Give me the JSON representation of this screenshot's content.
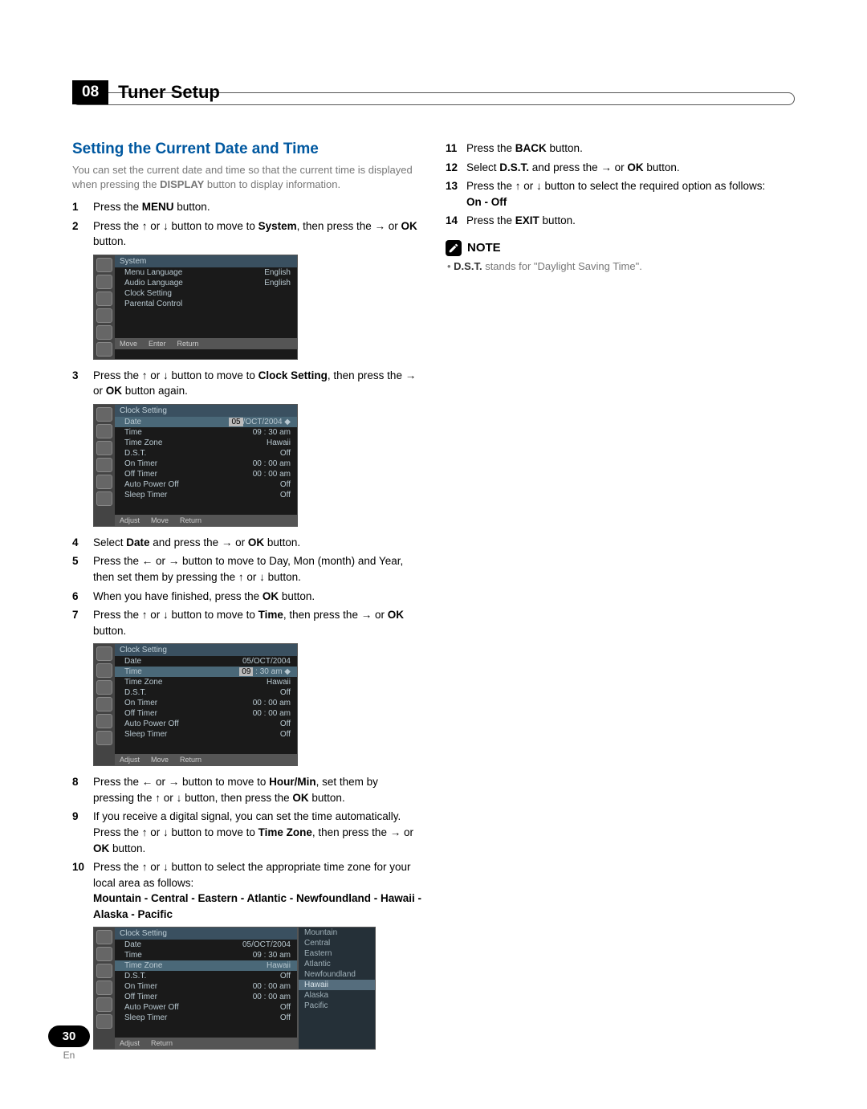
{
  "chapter": {
    "number": "08",
    "title": "Tuner Setup"
  },
  "section": {
    "heading": "Setting the Current Date and Time",
    "intro_a": "You can set the current date and time so that the current time is displayed when pressing the ",
    "intro_bold": "DISPLAY",
    "intro_b": " button to display information."
  },
  "left_steps": {
    "s1": {
      "n": "1",
      "a": "Press the ",
      "b": "MENU",
      "c": " button."
    },
    "s2": {
      "n": "2",
      "a": "Press the ",
      "b1": "↑",
      "mid1": " or ",
      "b2": "↓",
      "c": " button to move to ",
      "d": "System",
      "e": ", then press the ",
      "f": "→",
      "g": " or ",
      "h": "OK",
      "i": " button."
    },
    "s3": {
      "n": "3",
      "a": "Press the ",
      "b1": "↑",
      "mid1": " or ",
      "b2": "↓",
      "c": " button to move to ",
      "d": "Clock Setting",
      "e": ", then press the ",
      "f": "→",
      "g": " or ",
      "h": "OK",
      "i": " button again."
    },
    "s4": {
      "n": "4",
      "a": "Select ",
      "b": "Date",
      "c": " and press the ",
      "d": "→",
      "e": " or ",
      "f": "OK",
      "g": " button."
    },
    "s5": {
      "n": "5",
      "a": "Press the ",
      "b1": "←",
      "mid1": " or ",
      "b2": "→",
      "c": " button to move to Day, Mon (month) and Year, then set them by pressing the ",
      "d1": "↑",
      "mid2": " or ",
      "d2": "↓",
      "e": " button."
    },
    "s6": {
      "n": "6",
      "a": "When you have finished, press the ",
      "b": "OK",
      "c": " button."
    },
    "s7": {
      "n": "7",
      "a": "Press the ",
      "b1": "↑",
      "mid1": " or ",
      "b2": "↓",
      "c": " button to move to ",
      "d": "Time",
      "e": ", then press the ",
      "f": "→",
      "g": " or ",
      "h": "OK",
      "i": " button."
    },
    "s8": {
      "n": "8",
      "a": "Press the ",
      "b1": "←",
      "mid1": " or ",
      "b2": "→",
      "c": " button to move to ",
      "d": "Hour/Min",
      "e": ", set them by pressing the ",
      "f1": "↑",
      "mid2": " or ",
      "f2": "↓",
      "g": " button, then press the ",
      "h": "OK",
      "i": " button."
    },
    "s9": {
      "n": "9",
      "a": "If you receive a digital signal, you can set the time automatically. Press the ",
      "b1": "↑",
      "mid1": " or ",
      "b2": "↓",
      "c": " button to move to ",
      "d": "Time Zone",
      "e": ", then press the ",
      "f": "→",
      "g": " or ",
      "h": "OK",
      "i": " button."
    },
    "s10": {
      "n": "10",
      "a": "Press the ",
      "b1": "↑",
      "mid1": " or ",
      "b2": "↓",
      "c": " button to select the appropriate time zone for your local area as follows:",
      "list": "Mountain - Central - Eastern - Atlantic - Newfoundland - Hawaii - Alaska - Pacific"
    }
  },
  "right_steps": {
    "s11": {
      "n": "11",
      "a": "Press the ",
      "b": "BACK",
      "c": " button."
    },
    "s12": {
      "n": "12",
      "a": "Select ",
      "b": "D.S.T.",
      "c": " and press the ",
      "d": "→",
      "e": " or ",
      "f": "OK",
      "g": " button."
    },
    "s13": {
      "n": "13",
      "a": "Press the ",
      "b1": "↑",
      "mid1": " or ",
      "b2": "↓",
      "c": " button to select the required option as follows:",
      "opts": "On - Off"
    },
    "s14": {
      "n": "14",
      "a": "Press the ",
      "b": "EXIT",
      "c": " button."
    }
  },
  "note": {
    "label": "NOTE",
    "bullet": "• ",
    "bold": "D.S.T.",
    "text": " stands for \"Daylight Saving Time\"."
  },
  "osd1": {
    "title": "System",
    "rows": [
      {
        "label": "Menu Language",
        "value": "English"
      },
      {
        "label": "Audio Language",
        "value": "English"
      },
      {
        "label": "Clock Setting",
        "value": ""
      },
      {
        "label": "Parental Control",
        "value": ""
      }
    ],
    "footer": [
      "Move",
      "Enter",
      "Return"
    ]
  },
  "osd2": {
    "title": "Clock Setting",
    "rows": [
      {
        "label": "Date",
        "value": "05/OCT/2004",
        "hl": true,
        "valpre": "05"
      },
      {
        "label": "Time",
        "value": "09 : 30 am"
      },
      {
        "label": "Time Zone",
        "value": "Hawaii"
      },
      {
        "label": "D.S.T.",
        "value": "Off"
      },
      {
        "label": "On Timer",
        "value": "00 : 00 am"
      },
      {
        "label": "Off Timer",
        "value": "00 : 00 am"
      },
      {
        "label": "Auto Power Off",
        "value": "Off"
      },
      {
        "label": "Sleep Timer",
        "value": "Off"
      }
    ],
    "footer": [
      "Adjust",
      "Move",
      "Return"
    ]
  },
  "osd3": {
    "title": "Clock Setting",
    "rows": [
      {
        "label": "Date",
        "value": "05/OCT/2004"
      },
      {
        "label": "Time",
        "value": "09 : 30 am",
        "hl": true,
        "valpre": "09"
      },
      {
        "label": "Time Zone",
        "value": "Hawaii"
      },
      {
        "label": "D.S.T.",
        "value": "Off"
      },
      {
        "label": "On Timer",
        "value": "00 : 00 am"
      },
      {
        "label": "Off Timer",
        "value": "00 : 00 am"
      },
      {
        "label": "Auto Power Off",
        "value": "Off"
      },
      {
        "label": "Sleep Timer",
        "value": "Off"
      }
    ],
    "footer": [
      "Adjust",
      "Move",
      "Return"
    ]
  },
  "osd4": {
    "title": "Clock Setting",
    "rows": [
      {
        "label": "Date",
        "value": "05/OCT/2004"
      },
      {
        "label": "Time",
        "value": "09 : 30 am"
      },
      {
        "label": "Time Zone",
        "value": "Hawaii",
        "hl": true
      },
      {
        "label": "D.S.T.",
        "value": "Off"
      },
      {
        "label": "On Timer",
        "value": "00 : 00 am"
      },
      {
        "label": "Off Timer",
        "value": "00 : 00 am"
      },
      {
        "label": "Auto Power Off",
        "value": "Off"
      },
      {
        "label": "Sleep Timer",
        "value": "Off"
      }
    ],
    "footer": [
      "Adjust",
      "Return"
    ],
    "popup": [
      "Mountain",
      "Central",
      "Eastern",
      "Atlantic",
      "Newfoundland",
      "Hawaii",
      "Alaska",
      "Pacific"
    ],
    "popup_sel": "Hawaii"
  },
  "footer": {
    "page": "30",
    "lang": "En"
  }
}
